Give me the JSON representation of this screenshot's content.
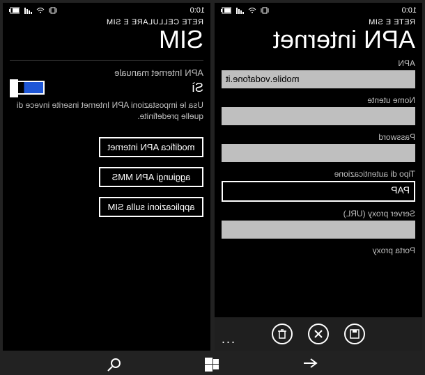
{
  "left": {
    "time": "10:0",
    "crumb": "RETE E SIM",
    "title": "APN internet",
    "fields": {
      "apn": {
        "label": "APN",
        "value": "mobile.vodafone.it"
      },
      "user": {
        "label": "Nome utente",
        "value": ""
      },
      "password": {
        "label": "Password",
        "value": ""
      },
      "auth": {
        "label": "Tipo di autenticazione",
        "value": "PAP"
      },
      "proxy": {
        "label": "Server proxy (URL)",
        "value": ""
      },
      "proxyport": {
        "label": "Porta proxy",
        "value": ""
      }
    },
    "appbar": {
      "save": "save",
      "cancel": "cancel",
      "delete": "delete",
      "more": "..."
    }
  },
  "right": {
    "time": "10:0",
    "crumb": "RETE CELLULARE E SIM",
    "title": "SIM",
    "toggle": {
      "label": "APN Internet manuale",
      "state": "Sì",
      "on": true
    },
    "hint": "Usa le impostazioni APN Internet inserite invece di quelle predefinite.",
    "buttons": {
      "edit_apn": "modifica APN internet",
      "add_mms": "aggiungi APN MMS",
      "sim_apps": "applicazioni sulla SIM"
    }
  },
  "nav": {
    "back": "back",
    "start": "start",
    "search": "search"
  }
}
